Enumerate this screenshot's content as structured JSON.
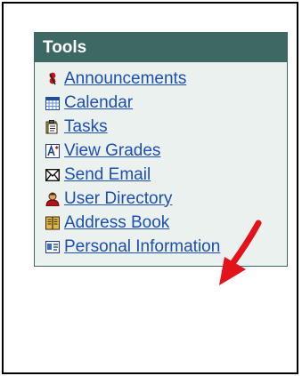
{
  "tools": {
    "title": "Tools",
    "items": [
      {
        "label": "Announcements",
        "icon": "pushpin-icon"
      },
      {
        "label": "Calendar",
        "icon": "calendar-icon"
      },
      {
        "label": "Tasks",
        "icon": "clipboard-icon"
      },
      {
        "label": "View Grades",
        "icon": "grades-icon"
      },
      {
        "label": "Send Email",
        "icon": "envelope-icon"
      },
      {
        "label": "User Directory",
        "icon": "user-icon"
      },
      {
        "label": "Address Book",
        "icon": "book-icon"
      },
      {
        "label": "Personal Information",
        "icon": "id-card-icon"
      }
    ]
  },
  "colors": {
    "header_bg": "#3d6863",
    "panel_bg": "#eaf1ef",
    "link": "#1c4faf",
    "arrow": "#e2131a"
  }
}
